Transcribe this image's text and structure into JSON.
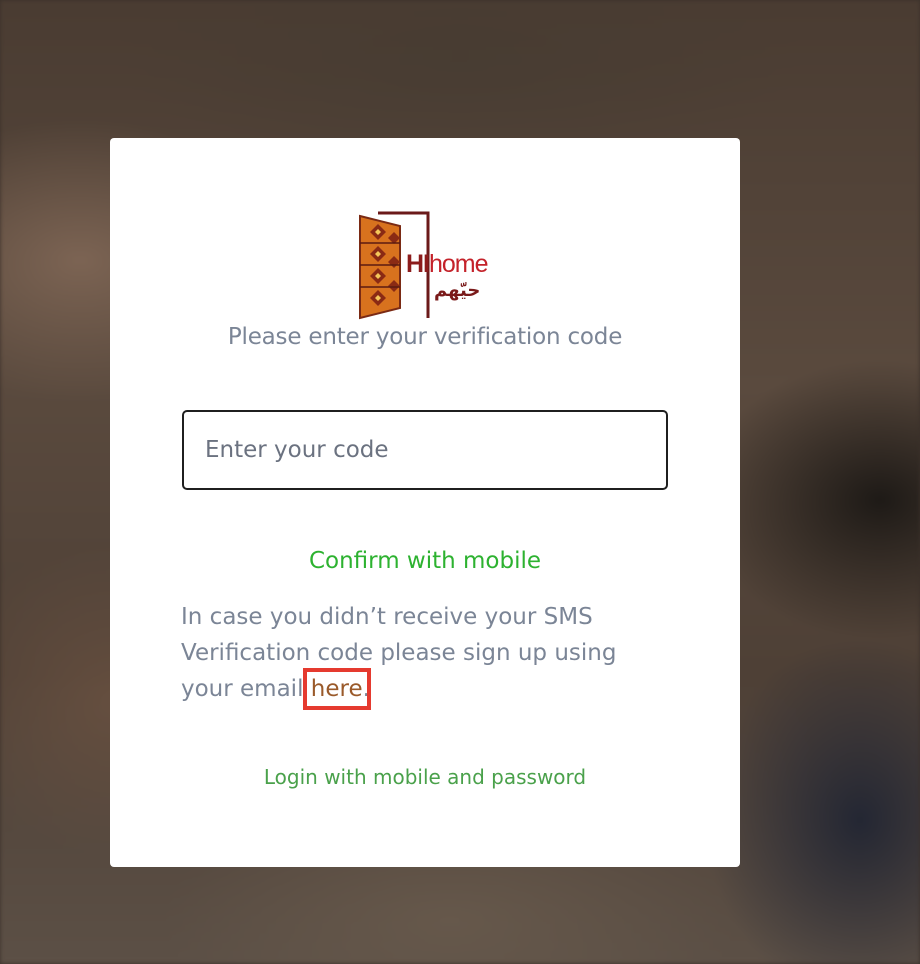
{
  "brand": {
    "name_prefix": "HI",
    "name_suffix": "home",
    "arabic_name": "حيّهم",
    "colors": {
      "dark_red": "#8c1c1c",
      "red": "#c4222a",
      "orange": "#d8721e"
    }
  },
  "verification": {
    "subtitle": "Please enter your verification code",
    "code_placeholder": "Enter your code",
    "confirm_label": "Confirm with mobile",
    "note_text": "In case you didn’t receive your SMS Verification code please sign up using your email ",
    "here_link": "here",
    "note_end": ".",
    "login_alt_label": "Login with mobile and password"
  },
  "colors": {
    "card": "#ffffff",
    "text_muted": "#7b8596",
    "confirm_green": "#2db230",
    "link_green": "#4aa14b",
    "here_brown": "#9a5a2a",
    "highlight_red": "#e53a2f"
  }
}
